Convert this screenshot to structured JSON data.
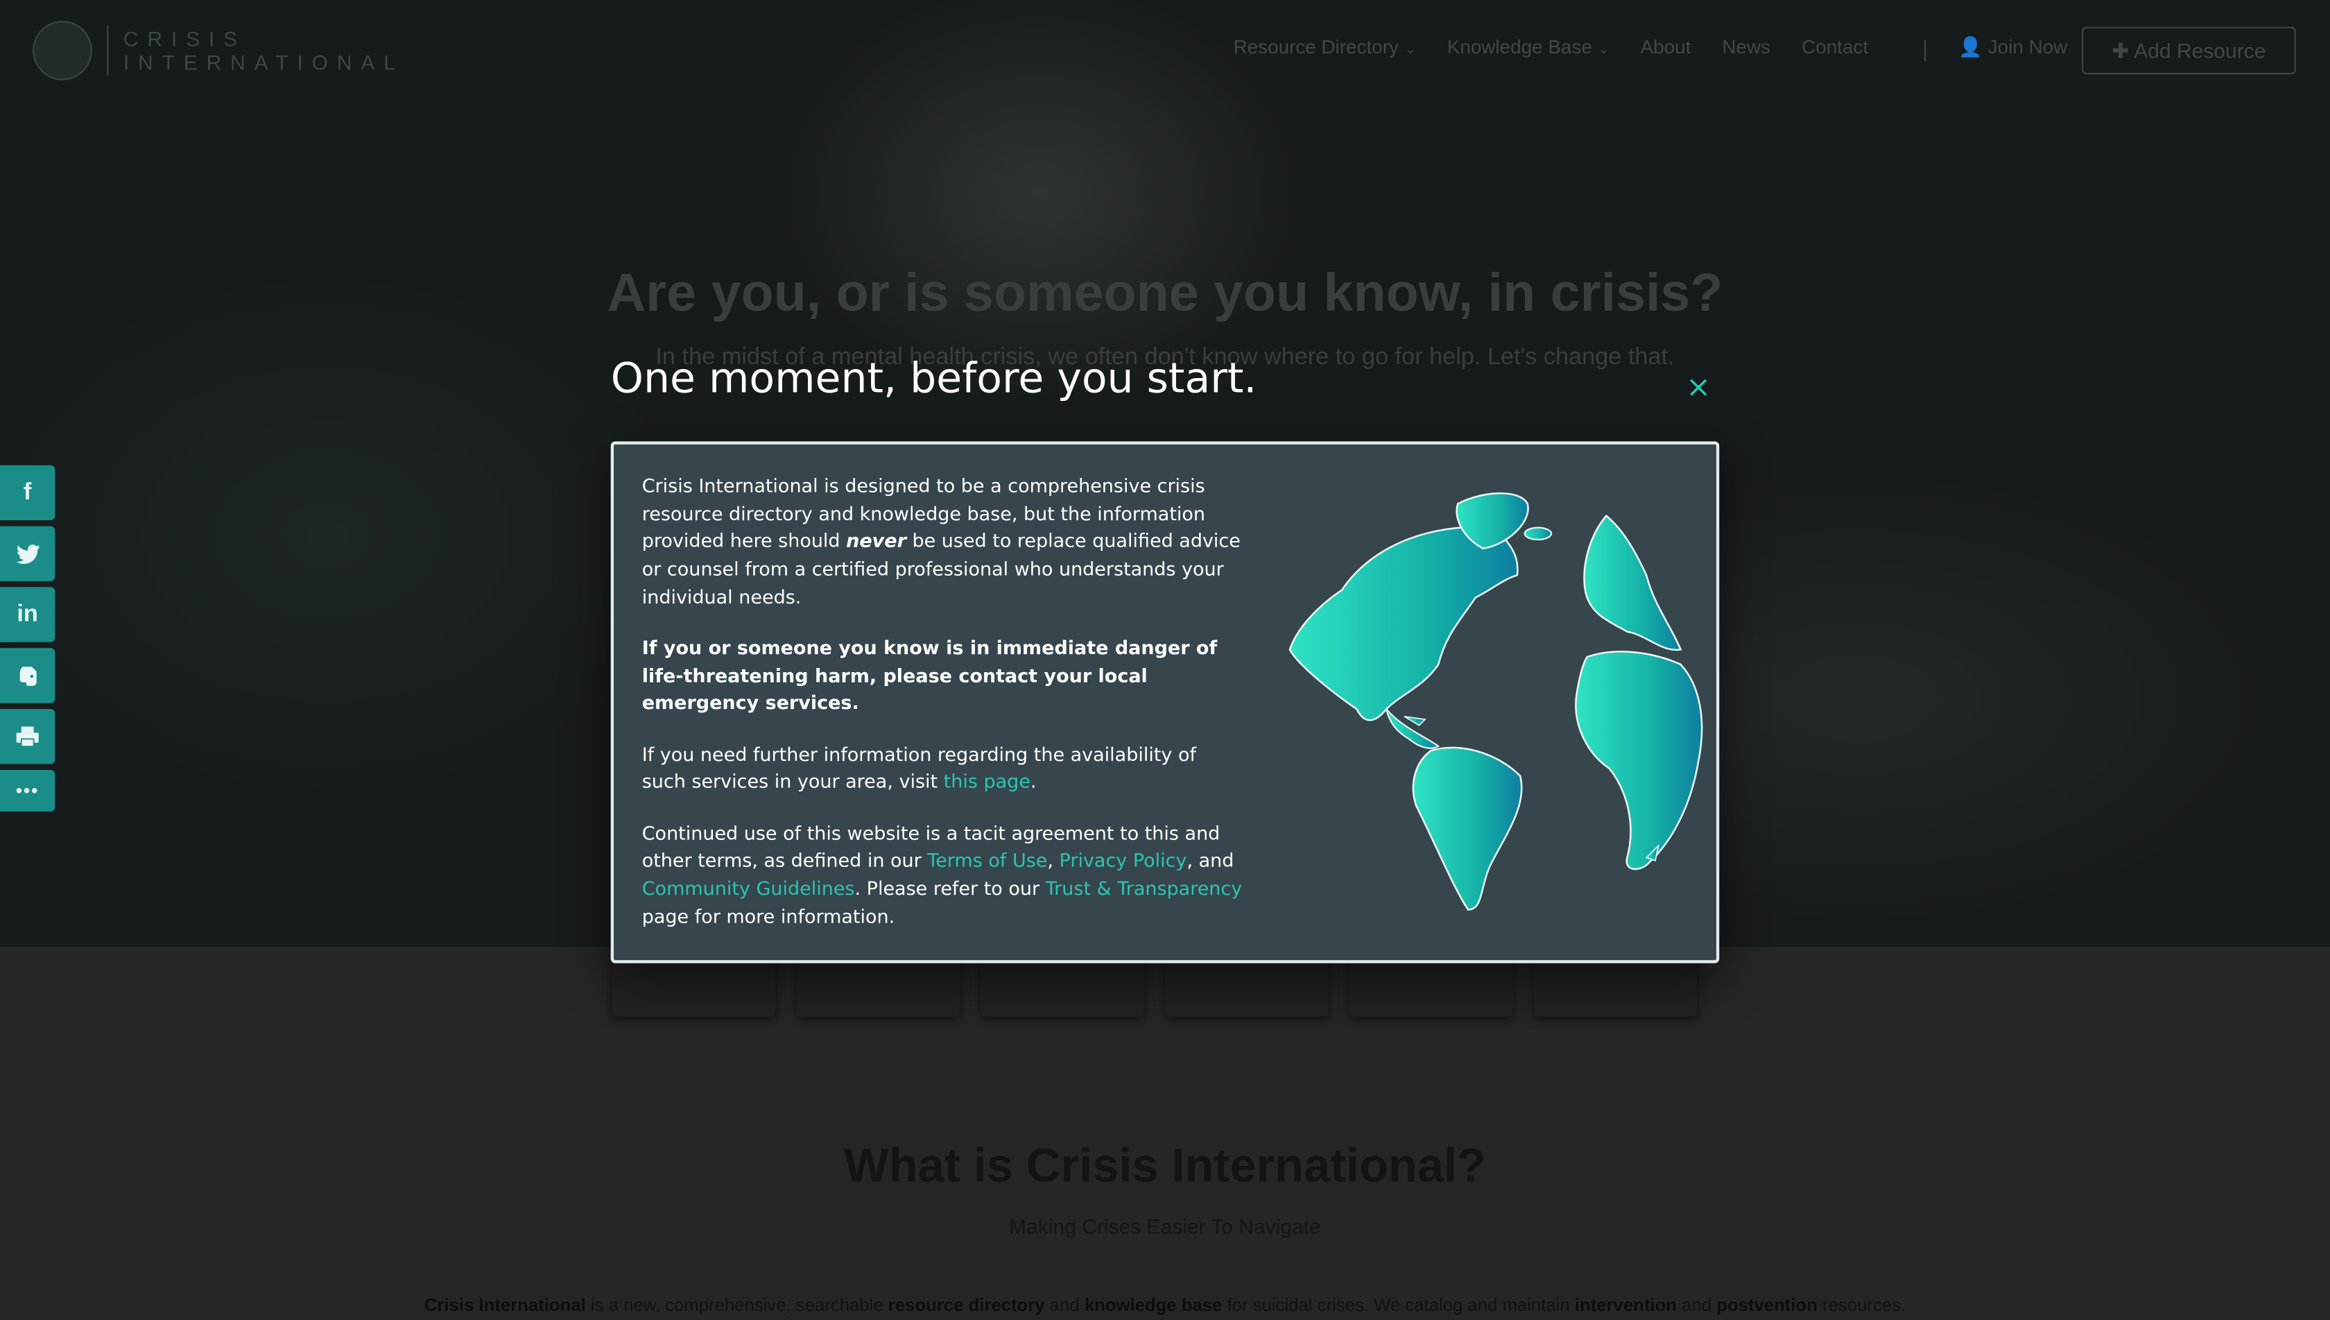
{
  "site": {
    "logo_line1": "CRISIS",
    "logo_line2": "INTERNATIONAL"
  },
  "nav": {
    "items": [
      {
        "label": "Resource Directory",
        "dropdown": true
      },
      {
        "label": "Knowledge Base",
        "dropdown": true
      },
      {
        "label": "About",
        "dropdown": false
      },
      {
        "label": "News",
        "dropdown": false
      },
      {
        "label": "Contact",
        "dropdown": false
      }
    ],
    "join_label": "Join Now",
    "add_resource_label": "Add Resource"
  },
  "hero": {
    "title": "Are you, or is someone you know, in crisis?",
    "subtitle": "In the midst of a mental health crisis, we often don't know where to go for help. Let's change that."
  },
  "section": {
    "title": "What is Crisis International?",
    "subtitle": "Making Crises Easier To Navigate",
    "intro_parts": [
      {
        "text": "Crisis International",
        "bold": true
      },
      {
        "text": " is a new, comprehensive, searchable ",
        "bold": false
      },
      {
        "text": "resource directory",
        "bold": true
      },
      {
        "text": " and ",
        "bold": false
      },
      {
        "text": "knowledge base",
        "bold": true
      },
      {
        "text": " for suicidal crises. We catalog and maintain ",
        "bold": false
      },
      {
        "text": "intervention",
        "bold": true
      },
      {
        "text": " and ",
        "bold": false
      },
      {
        "text": "postvention",
        "bold": true
      },
      {
        "text": " resources.",
        "bold": false
      }
    ]
  },
  "social": {
    "buttons": [
      {
        "icon": "facebook-icon",
        "glyph": "f"
      },
      {
        "icon": "twitter-icon",
        "glyph": "🐦"
      },
      {
        "icon": "linkedin-icon",
        "glyph": "in"
      },
      {
        "icon": "evernote-icon",
        "glyph": "🐘"
      },
      {
        "icon": "print-icon",
        "glyph": "🖶"
      },
      {
        "icon": "more-icon",
        "glyph": "•••"
      }
    ]
  },
  "modal": {
    "title": "One moment, before you start.",
    "close_glyph": "×",
    "p1_a": "Crisis International is designed to be a comprehensive crisis resource directory and knowledge base, but the information provided here should ",
    "p1_em": "never",
    "p1_b": " be used to replace qualified advice or counsel from a certified professional who understands your individual needs.",
    "p2": "If you or someone you know is in immediate danger of life-threatening harm, please contact your local emergency services.",
    "p3_a": "If you need further information regarding the availability of such services in your area, visit ",
    "p3_link": "this page",
    "p3_b": ".",
    "p4_a": "Continued use of this website is a tacit agreement to this and other terms, as defined in our ",
    "p4_link1": "Terms of Use",
    "p4_sep1": ", ",
    "p4_link2": "Privacy Policy",
    "p4_sep2": ", and ",
    "p4_link3": "Community Guidelines",
    "p4_mid": ". Please refer to our ",
    "p4_link4": "Trust & Transparency",
    "p4_end": " page for more information."
  },
  "colors": {
    "accent": "#2bc4b3",
    "modal_bg": "#37464d",
    "social_bg": "#1b8d89"
  }
}
